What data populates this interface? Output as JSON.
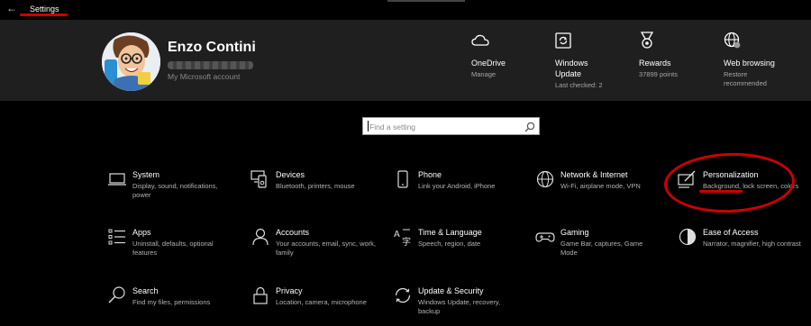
{
  "titlebar": {
    "back_glyph": "←",
    "title": "Settings"
  },
  "account": {
    "name": "Enzo Contini",
    "link": "My Microsoft account"
  },
  "quick_actions": [
    {
      "icon": "onedrive-cloud-icon",
      "title": "OneDrive",
      "sub": "Manage"
    },
    {
      "icon": "windows-update-icon",
      "title": "Windows\nUpdate",
      "sub": "Last checked: 2"
    },
    {
      "icon": "rewards-medal-icon",
      "title": "Rewards",
      "sub": "37899 points"
    },
    {
      "icon": "web-browsing-globe-icon",
      "title": "Web browsing",
      "sub": "Restore\nrecommended"
    }
  ],
  "search": {
    "placeholder": "Find a setting"
  },
  "tiles": [
    {
      "icon": "laptop-icon",
      "title": "System",
      "desc": "Display, sound, notifications, power"
    },
    {
      "icon": "devices-icon",
      "title": "Devices",
      "desc": "Bluetooth, printers, mouse"
    },
    {
      "icon": "phone-icon",
      "title": "Phone",
      "desc": "Link your Android, iPhone"
    },
    {
      "icon": "globe-icon",
      "title": "Network & Internet",
      "desc": "Wi-Fi, airplane mode, VPN"
    },
    {
      "icon": "personalization-icon",
      "title": "Personalization",
      "desc": "Background, lock screen, colors"
    },
    {
      "icon": "apps-list-icon",
      "title": "Apps",
      "desc": "Uninstall, defaults, optional features"
    },
    {
      "icon": "person-icon",
      "title": "Accounts",
      "desc": "Your accounts, email, sync, work, family"
    },
    {
      "icon": "time-language-icon",
      "title": "Time & Language",
      "desc": "Speech, region, date"
    },
    {
      "icon": "gamepad-icon",
      "title": "Gaming",
      "desc": "Game Bar, captures, Game Mode"
    },
    {
      "icon": "ease-of-access-icon",
      "title": "Ease of Access",
      "desc": "Narrator, magnifier, high contrast"
    },
    {
      "icon": "search-magnifier-icon",
      "title": "Search",
      "desc": "Find my files, permissions"
    },
    {
      "icon": "lock-icon",
      "title": "Privacy",
      "desc": "Location, camera, microphone"
    },
    {
      "icon": "update-sync-icon",
      "title": "Update & Security",
      "desc": "Windows Update, recovery, backup"
    }
  ],
  "colors": {
    "background": "#000000",
    "header": "#1f1f1f",
    "annotation": "#cc0000"
  }
}
